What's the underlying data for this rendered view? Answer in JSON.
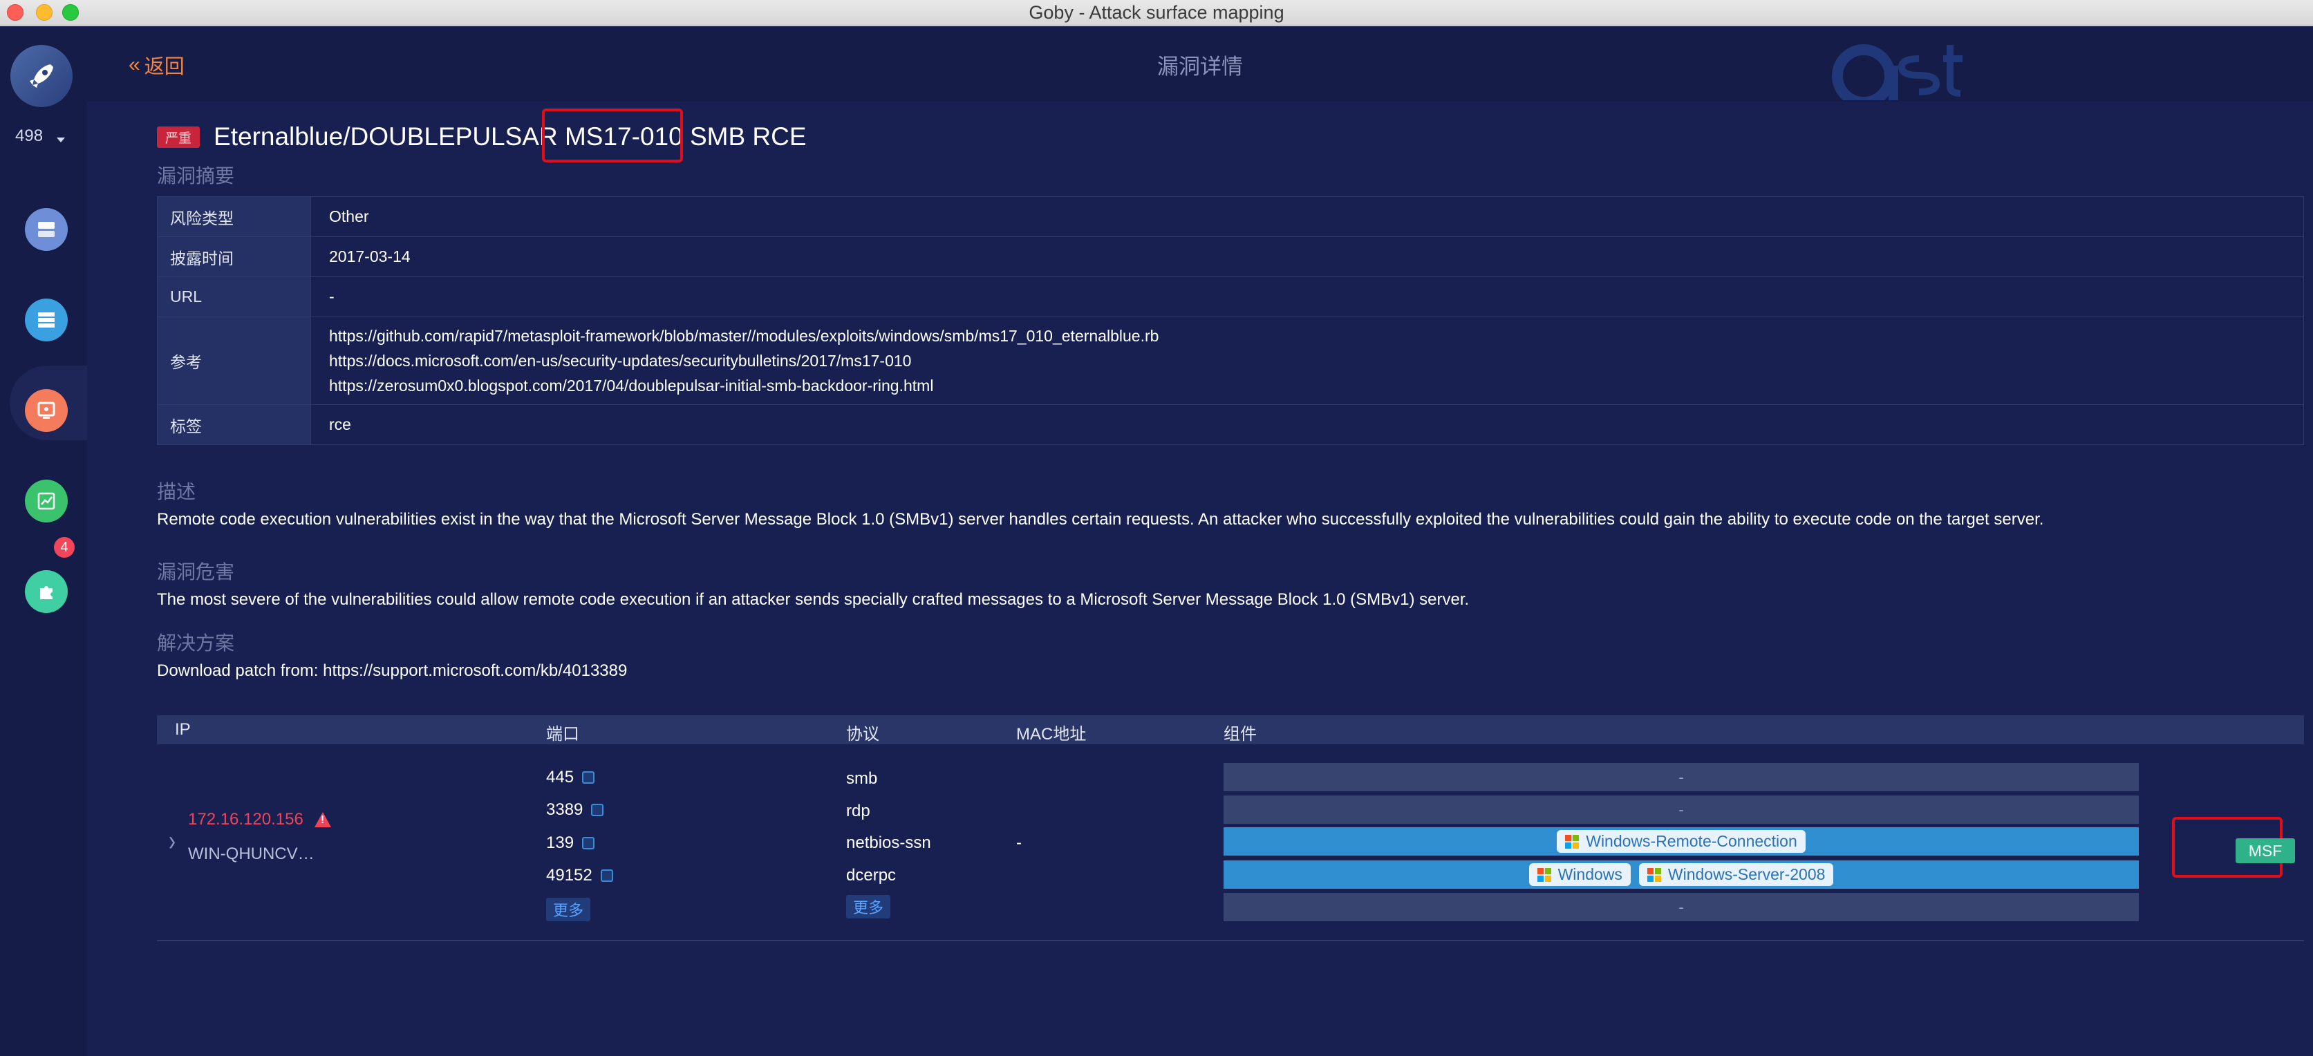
{
  "window": {
    "title": "Goby - Attack surface mapping"
  },
  "sidebar": {
    "count": "498",
    "items": [
      {
        "icon": "dashboard-icon",
        "color": "#6f8ed8"
      },
      {
        "icon": "server-list-icon",
        "color": "#3aa0e0"
      },
      {
        "icon": "vulnerability-icon",
        "color": "#f47b5c"
      },
      {
        "icon": "report-chart-icon",
        "color": "#3bc26d"
      },
      {
        "icon": "plugin-icon",
        "color": "#3fcfa3"
      }
    ],
    "plugin_badge": "4"
  },
  "topbar": {
    "back_label": "返回",
    "title": "漏洞详情"
  },
  "vuln": {
    "severity": "严重",
    "name": "Eternalblue/DOUBLEPULSAR MS17-010 SMB RCE",
    "summary_title": "漏洞摘要",
    "summary": [
      {
        "key": "风险类型",
        "value": "Other"
      },
      {
        "key": "披露时间",
        "value": "2017-03-14"
      },
      {
        "key": "URL",
        "value": "-"
      },
      {
        "key": "参考",
        "values": [
          "https://github.com/rapid7/metasploit-framework/blob/master//modules/exploits/windows/smb/ms17_010_eternalblue.rb",
          "https://docs.microsoft.com/en-us/security-updates/securitybulletins/2017/ms17-010",
          "https://zerosum0x0.blogspot.com/2017/04/doublepulsar-initial-smb-backdoor-ring.html"
        ]
      },
      {
        "key": "标签",
        "value": "rce"
      }
    ],
    "desc_title": "描述",
    "description": "Remote code execution vulnerabilities exist in the way that the Microsoft Server Message Block 1.0 (SMBv1) server handles certain requests. An attacker who successfully exploited the vulnerabilities could gain the ability to execute code on the target server.",
    "impact_title": "漏洞危害",
    "impact": "The most severe of the vulnerabilities could allow remote code execution if an attacker sends specially crafted messages to a Microsoft Server Message Block 1.0 (SMBv1) server.",
    "solution_title": "解决方案",
    "solution": "Download patch from: https://support.microsoft.com/kb/4013389"
  },
  "hosts": {
    "columns": {
      "ip": "IP",
      "port": "端口",
      "protocol": "协议",
      "mac": "MAC地址",
      "component": "组件"
    },
    "row": {
      "ip": "172.16.120.156",
      "hostname": "WIN-QHUNCV…",
      "ports": [
        "445",
        "3389",
        "139",
        "49152"
      ],
      "protocols": [
        "smb",
        "rdp",
        "netbios-ssn",
        "dcerpc"
      ],
      "more_label": "更多",
      "mac": "-",
      "components": [
        {
          "placeholder": "-"
        },
        {
          "placeholder": "-"
        },
        {
          "tags": [
            "Windows-Remote-Connection"
          ]
        },
        {
          "tags": [
            "Windows",
            "Windows-Server-2008"
          ]
        },
        {
          "placeholder": "-"
        }
      ],
      "action_label": "MSF"
    }
  },
  "colors": {
    "accent_orange": "#f5853f",
    "danger_red": "#f04358",
    "msf_green": "#2fb289",
    "highlight_red": "#e00e1a"
  }
}
